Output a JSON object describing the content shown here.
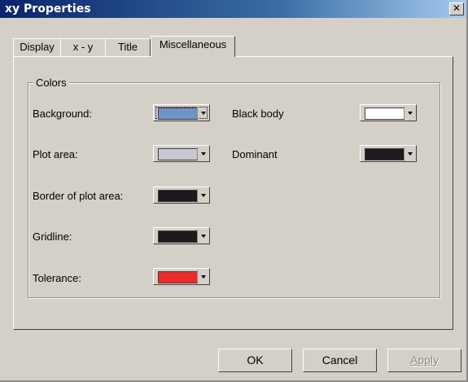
{
  "window": {
    "title": "xy Properties",
    "close_glyph": "✕"
  },
  "tabs": [
    {
      "label": "Display",
      "active": false
    },
    {
      "label": "x - y",
      "active": false
    },
    {
      "label": "Title",
      "active": false
    },
    {
      "label": "Miscellaneous",
      "active": true
    }
  ],
  "colors_group": {
    "legend": "Colors",
    "left": [
      {
        "label": "Background:",
        "color": "#6f93c6",
        "focused": true
      },
      {
        "label": "Plot area:",
        "color": "#c9c7cf",
        "focused": false
      },
      {
        "label": "Border of plot area:",
        "color": "#1c1a1c",
        "focused": false
      },
      {
        "label": "Gridline:",
        "color": "#1c1a1c",
        "focused": false
      },
      {
        "label": "Tolerance:",
        "color": "#ec2b2b",
        "focused": false
      }
    ],
    "right": [
      {
        "label": "Black body",
        "color": "#ffffff",
        "focused": false
      },
      {
        "label": "Dominant",
        "color": "#1c1a1c",
        "focused": false
      }
    ]
  },
  "buttons": {
    "ok": "OK",
    "cancel": "Cancel",
    "apply": "Apply"
  },
  "icons": {
    "dropdown": "chevron-down-icon",
    "close": "close-icon"
  }
}
